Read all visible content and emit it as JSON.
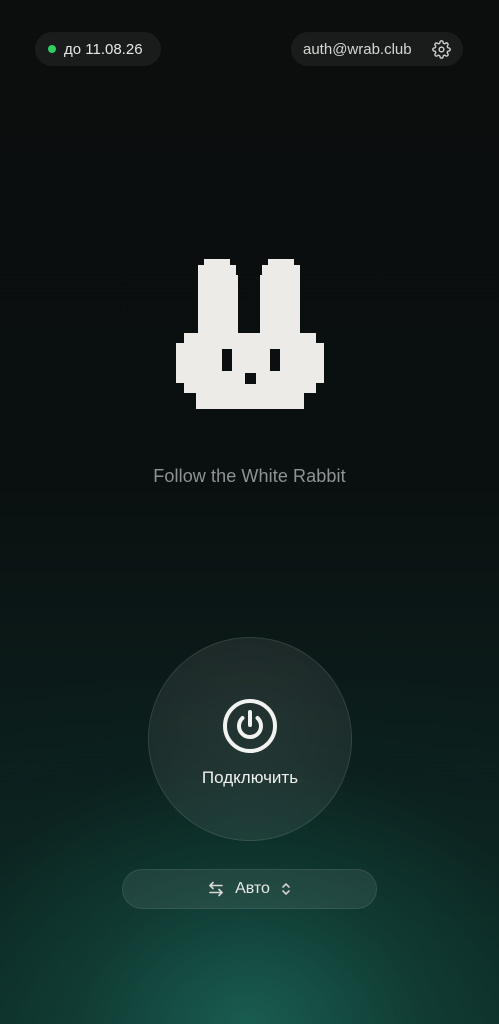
{
  "subscription": {
    "status_color": "#2fcf62",
    "expiry_text": "до 11.08.26"
  },
  "account": {
    "email": "auth@wrab.club",
    "settings_icon": "gear-icon"
  },
  "logo": {
    "icon": "rabbit-logo",
    "color": "#ecebe7"
  },
  "tagline": "Follow the White Rabbit",
  "connect": {
    "icon": "power-icon",
    "label": "Подключить"
  },
  "mode": {
    "icon": "swap-arrows-icon",
    "selected": "Авто",
    "chevron": "chevron-up-down-icon"
  }
}
